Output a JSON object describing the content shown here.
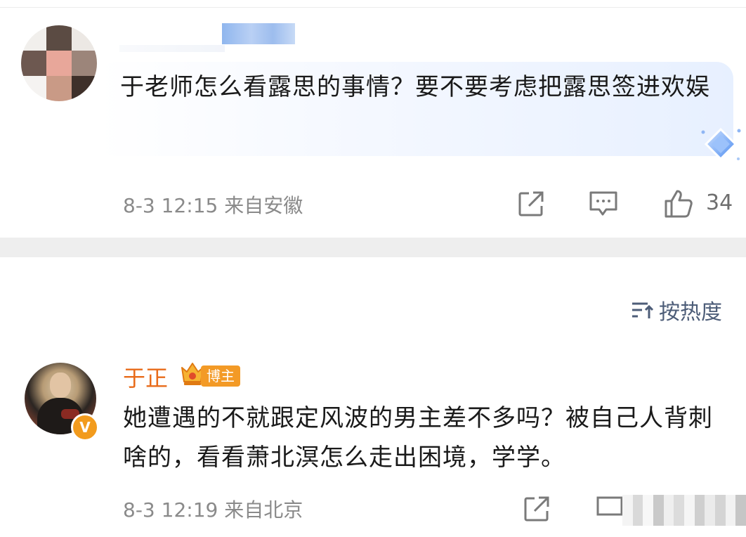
{
  "first_comment": {
    "text": "于老师怎么看露思的事情？要不要考虑把露思签进欢娱",
    "meta": "8-3 12:15 来自安徽",
    "share_icon": "share-square-icon",
    "comment_icon": "comment-bubble-icon",
    "like_icon": "thumbs-up-icon",
    "like_count": "34"
  },
  "sort": {
    "label": "按热度",
    "icon": "sort-lines-icon"
  },
  "second_comment": {
    "author": "于正",
    "badge": "博主",
    "verified_mark": "V",
    "text": "她遭遇的不就跟定风波的男主差不多吗？被自己人背刺啥的，看看萧北溟怎么走出困境，学学。",
    "meta": "8-3 12:19 来自北京",
    "share_icon": "share-square-icon",
    "comment_icon": "comment-bubble-icon"
  },
  "colors": {
    "author_orange": "#e86b1a",
    "badge_orange": "#f39a26",
    "meta_gray": "#8a8a8a",
    "sort_blue_gray": "#4d5d78"
  }
}
